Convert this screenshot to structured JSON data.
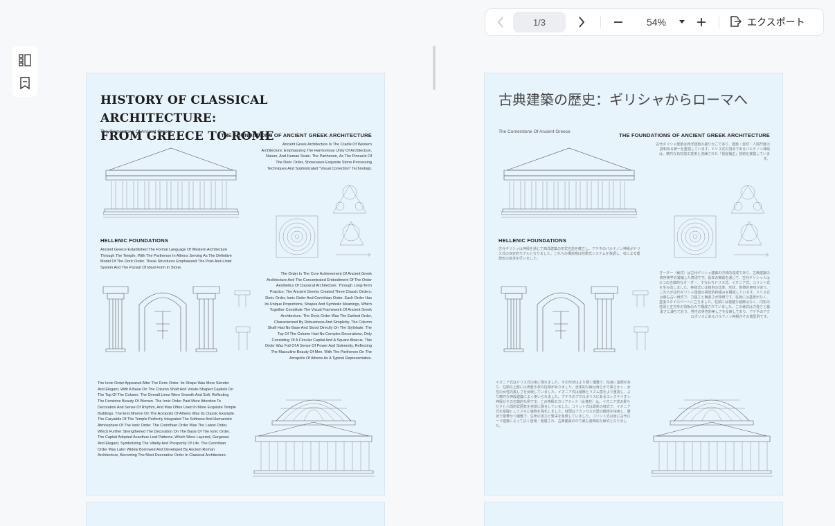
{
  "toolbar": {
    "page_indicator": "1/3",
    "zoom": "54%",
    "export_label": "エクスポート",
    "icons": {
      "prev": "chevron-left-icon",
      "next": "chevron-right-icon",
      "zoom_out": "minus-icon",
      "zoom_menu": "caret-down-icon",
      "zoom_in": "plus-icon",
      "export": "export-icon"
    }
  },
  "sidebar": {
    "icons": [
      "page-thumbnails-icon",
      "bookmark-icon"
    ]
  },
  "page1": {
    "title_line1": "HISTORY OF CLASSICAL  ARCHITECTURE:",
    "title_line2": "FROM GREECE TO ROME",
    "caption_parthenon": "The Cornerstone Of Ancient Greece",
    "foundations_heading": "THE FOUNDATIONS OF ANCIENT GREEK ARCHITECTURE",
    "foundations_text": "Ancient Greek Architecture Is The Cradle Of Western Architecture, Emphasizing The Harmonious Unity Of Architecture, Nature, And Human Scale. The Parthenon, As The Pinnacle Of The Doric Order, Showcases Exquisite Stone Processing Techniques And Sophisticated \"Visual Correction\" Technology.",
    "hellenic_heading": "HELLENIC FOUNDATIONS",
    "hellenic_text": "Ancient Greece Established The Formal Language Of Western Architecture Through The Temple, With The Parthenon In Athens Serving As The Definitive Model Of The Doric Order. These Structures Emphasized The Post-And-Lintel System And The Pursuit Of Ideal Form In Stone.",
    "orders_text": "The Order Is The Core Achievement Of Ancient Greek Architecture And The Concentrated Embodiment Of The Order Aesthetics Of Classical Architecture. Through Long-Term Practice, The Ancient Greeks Created Three Classic Orders: Doric Order, Ionic Order And Corinthian Order. Each Order Has Its Unique Proportions, Shapes And Symbolic Meanings, Which Together Constitute The Visual Framework Of Ancient Greek Architecture. The Doric Order Was The Earliest Order, Characterized By Robustness And Simplicity. The Column Shaft Had No Base And Stood Directly On The Stylobate. The Top Of The Column Had No Complex Decorations, Only Consisting Of A Circular Capital And A Square Abacus. This Order Was Full Of A Sense Of Power And Solemnity, Reflecting The Masculine Beauty Of Men. With The Parthenon On The Acropolis Of Athens As A Typical Representative.",
    "ionic_text": "The Ionic Order Appeared After The Doric Order. Its Shape Was More Slender And Elegant, With A Base On The Column Shaft And Volute-Shaped Capitals On The Top Of The Column. The Overall Lines Were Smooth And Soft, Reflecting The Feminine Beauty Of Women. The Ionic Order Paid More Attention To Decoration And Sense Of Rhythm, And Was Often Used In More Exquisite Temple Buildings. The Erechtheion On The Acropolis Of Athens Was Its Classic Example. The Caryatids Of The Temple Perfectly Integrated The Softness And Humanistic Atmosphere Of The Ionic Order. The Corinthian Order Was The Latest Order, Which Further Strengthened The Decoration On The Basis Of The Ionic Order. The Capital Adopted Acanthus Leaf Patterns, Which Were Layered, Gorgeous And Elegant, Symbolizing The Vitality And Prosperity Of Life. The Corinthian Order Was Later Widely Borrowed And Developed By Ancient Roman Architecture, Becoming The Most Decorative Order In Classical Architecture."
  },
  "page2": {
    "title": "古典建築の歴史：ギリシャからローマへ",
    "caption_parthenon": "The Cornerstone Of Ancient Greece",
    "foundations_heading": "THE FOUNDATIONS OF ANCIENT GREEK ARCHITECTURE",
    "foundations_text": "古代ギリシャ建築は西洋建築の揺りかごであり、建築・自然・人間尺度の調和ある統一を重視しています。ドリス式の頂点であるパルテノン神殿は、精巧な石材加工技術と洗練された「視覚補正」技術を披露しています。",
    "hellenic_heading": "HELLENIC FOUNDATIONS",
    "hellenic_text": "古代ギリシャは神殿を通じて西洋建築の形式言語を確立し、アテネのパルテノン神殿がドリス式の決定的モデルとなりました。これらの構造物は柱梁式システムを強調し、石による理想形の追求を行いました。",
    "orders_text": "オーダー（様式）は古代ギリシャ建築の中核的達成であり、古典建築の秩序美学の凝縮した表現です。長年の実践を通じて、古代ギリシャ人は三つの古典的なオーダー、すなわちドリス式、イオニア式、コリント式を生み出しました。各様式には独自の比率、形状、象徴的意味があり、これらが古代ギリシャ建築の視覚的枠組みを構成しています。ドリス式は最も古い様式で、力強さと簡素さが特徴です。柱身には基部がなく、直接スタイロベートに立ちました。柱頭には複雑な装飾はなく、円形の柱頭と正方形の頂板のみで構成されていました。この様式は力強さと厳粛さに満ちており、男性の男性的美しさを反映しており、アテネのアクロポリスにあるパルテノン神殿がその典型例です。",
    "ionic_text": "イオニア式はドリス式の後に現れました。その形状はより細く優雅で、柱身に基部があり、柱頭の上部には渦巻き状の柱頭がありました。全体的な線は滑らかで柔らかく、女性の女性的美しさを反映していました。イオニア式は装飾とリズム感をより重視し、より精巧な神殿建築によく用いられました。アテネのアクロポリスにあるエレクテイオン神殿がその古典的な例です。この神殿のカリアティド（女像柱）は、イオニア式の柔らかさと人間的雰囲気を完璧に融合していました。コリント式は最新の様式で、イオニア式を基礎としてさらに装飾を強化しました。柱頭はアカンサスの葉の模様を採用し、層状で豪華かつ優雅で、生命の活力と繁栄を象徴していました。コリント式は後に古代ローマ建築によって広く借用・発展され、古典建築の中で最も装飾的な様式となりました。"
  }
}
